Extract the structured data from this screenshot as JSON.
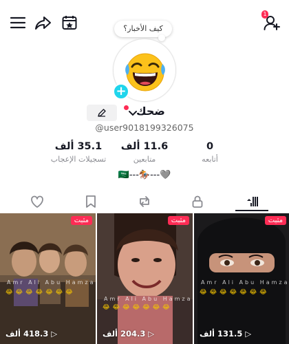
{
  "colors": {
    "accent": "#fe2c55",
    "cyan": "#20d5ec",
    "text": "#161823",
    "muted": "#8a8b91"
  },
  "topbar": {
    "menu_icon": "hamburger-menu-icon",
    "share_icon": "share-arrow-icon",
    "calendar_icon": "calendar-star-icon",
    "add_friend_icon": "add-person-icon",
    "notification_count": "1"
  },
  "profile": {
    "bubble_text": "كيف الأخبار؟",
    "display_name": "ضحك",
    "username": "@user9018199326075",
    "bio": "🩶---🏇---🇸🇦"
  },
  "stats": [
    {
      "value": "35.1 ألف",
      "label": "تسجيلات الإعجاب"
    },
    {
      "value": "11.6 ألف",
      "label": "متابعين"
    },
    {
      "value": "0",
      "label": "أتابعه"
    }
  ],
  "tabs": [
    {
      "icon": "heart-icon"
    },
    {
      "icon": "bookmark-icon"
    },
    {
      "icon": "repost-icon"
    },
    {
      "icon": "lock-icon"
    },
    {
      "icon": "grid-videos-icon",
      "active": true
    }
  ],
  "videos": [
    {
      "pinned_label": "مثبت",
      "views": "418.3 ألف",
      "watermark": "Amr Ali Abu Hamza"
    },
    {
      "pinned_label": "مثبت",
      "views": "204.3 ألف",
      "watermark": "Amr Ali Abu Hamza"
    },
    {
      "pinned_label": "مثبت",
      "views": "131.5 ألف",
      "watermark": "Amr Ali Abu Hamza"
    }
  ]
}
